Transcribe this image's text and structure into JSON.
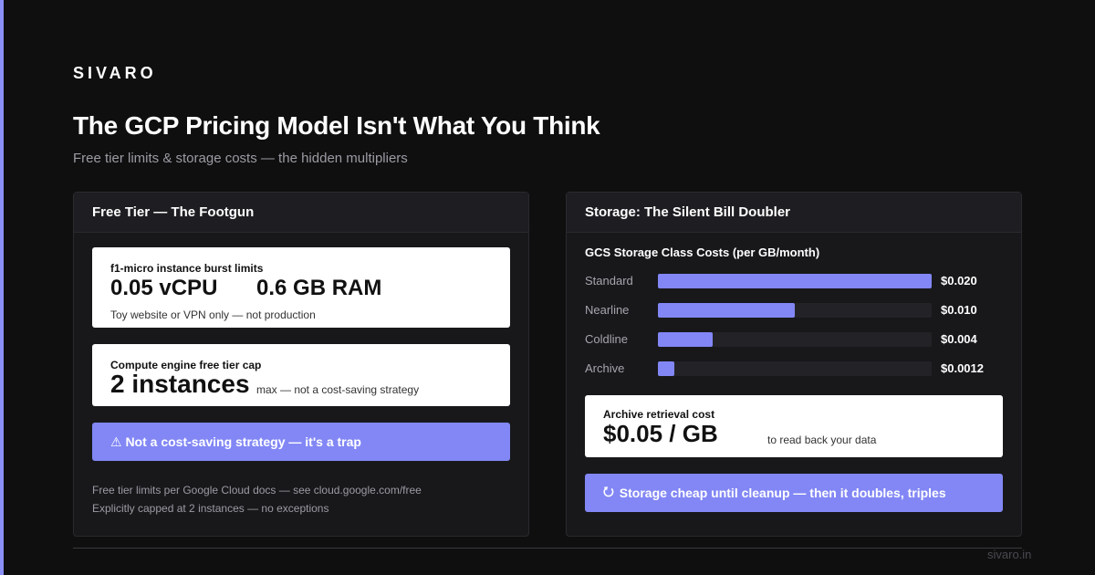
{
  "brand": {
    "logo": "SIVARO",
    "accent": "#8287f5",
    "footer_site": "sivaro.in"
  },
  "header": {
    "title": "The GCP Pricing Model Isn't What You Think",
    "subtitle": "Free tier limits & storage costs — the hidden multipliers"
  },
  "left_panel": {
    "title": "Free Tier — The Footgun",
    "card1": {
      "label": "f1-micro instance burst limits",
      "vcpu": "0.05 vCPU",
      "ram": "0.6 GB RAM",
      "note": "Toy website or VPN only — not production"
    },
    "card2": {
      "label": "Compute engine free tier cap",
      "value": "2 instances",
      "note": "max — not a cost-saving strategy"
    },
    "cta": {
      "icon": "warning-icon",
      "text": "⚠ Not a cost-saving strategy — it's a trap"
    },
    "footnotes": [
      "Free tier limits per Google Cloud docs — see cloud.google.com/free",
      "Explicitly capped at 2 instances — no exceptions"
    ]
  },
  "right_panel": {
    "title": "Storage: The Silent Bill Doubler",
    "chart_data": {
      "type": "bar",
      "title": "GCS Storage Class Costs (per GB/month)",
      "categories": [
        "Standard",
        "Nearline",
        "Coldline",
        "Archive"
      ],
      "values": [
        0.02,
        0.01,
        0.004,
        0.0012
      ],
      "value_labels": [
        "$0.020",
        "$0.010",
        "$0.004",
        "$0.0012"
      ],
      "xlim": [
        0,
        0.02
      ],
      "orientation": "horizontal",
      "bar_color": "#8287f5"
    },
    "card": {
      "label": "Archive retrieval cost",
      "value": "$0.05 / GB",
      "note": "to read back your data"
    },
    "cta": {
      "icon": "refresh-icon",
      "glyph": "⭮",
      "text": "Storage cheap until cleanup — then it doubles, triples"
    }
  }
}
